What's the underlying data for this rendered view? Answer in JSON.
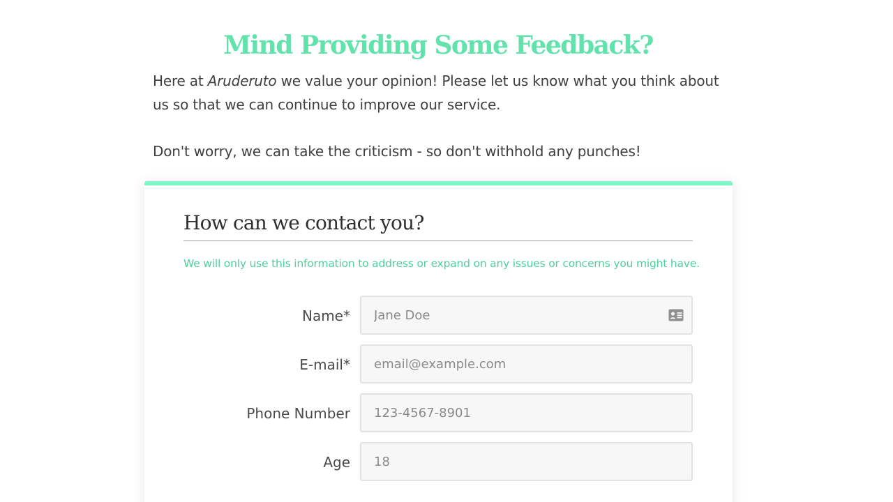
{
  "header": {
    "title": "Mind Providing Some Feedback?",
    "intro_before": "Here at ",
    "brand": "Aruderuto",
    "intro_after": " we value your opinion! Please let us know what you think about us so that we can continue to improve our service.",
    "reassurance": "Don't worry, we can take the criticism - so don't withhold any punches!"
  },
  "contact_section": {
    "title": "How can we contact you?",
    "note": "We will only use this information to address or expand on any issues or concerns you might have.",
    "fields": {
      "name": {
        "label": "Name*",
        "placeholder": "Jane Doe",
        "value": "",
        "icon": "id-card-icon"
      },
      "email": {
        "label": "E-mail*",
        "placeholder": "email@example.com",
        "value": ""
      },
      "phone": {
        "label": "Phone Number",
        "placeholder": "123-4567-8901",
        "value": ""
      },
      "age": {
        "label": "Age",
        "placeholder": "18",
        "value": ""
      }
    }
  },
  "colors": {
    "accent": "#62e3ac",
    "card_border": "#7ef7c8",
    "note_text": "#4fcf99"
  }
}
